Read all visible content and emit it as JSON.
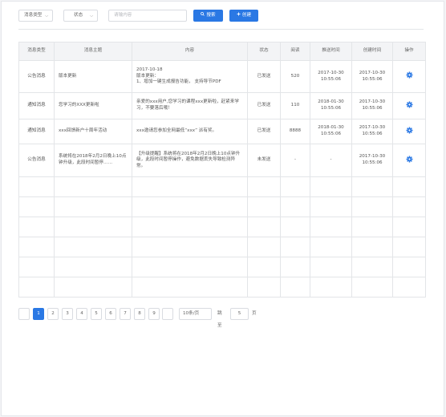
{
  "toolbar": {
    "type_select": "消息类型",
    "status_select": "状态",
    "search_placeholder": "请输内容",
    "search_button": "搜索",
    "create_button": "创建"
  },
  "table": {
    "columns": [
      "消息类型",
      "消息主题",
      "内容",
      "状态",
      "阅读",
      "推送时间",
      "创建时间",
      "操作"
    ],
    "rows": [
      {
        "type": "公告消息",
        "subject": "版本更新",
        "content": "2017-10-18\n版本更新：\n1、增加一键生成报告功能， 支持导节PDF",
        "status": "已发送",
        "reads": "520",
        "push_time": "2017-10-30\n10:55:06",
        "create_time": "2017-10-30\n10:55:06"
      },
      {
        "type": "通知消息",
        "subject": "您学习的XXX更新啦",
        "content": "亲爱的xxx用户,您学习的课程xxx更新啦，赶紧来学习，不要落后哦！",
        "status": "已发送",
        "reads": "110",
        "push_time": "2018-01-30\n10:55:06",
        "create_time": "2017-10-30\n10:55:06"
      },
      {
        "type": "通知消息",
        "subject": "xxx回馈新户十周年活动",
        "content": "xxx邀请您参加全网最低“xxx” 派有奖。",
        "status": "已发送",
        "reads": "8888",
        "push_time": "2018-01-30\n10:55:06",
        "create_time": "2017-10-30\n10:55:06"
      },
      {
        "type": "公告消息",
        "subject": "系统将在2018年2月2日晚上10点钟升级，此段时间暂停……",
        "content": "【升级提醒】系统将在2018年2月2日晚上10点钟升级，此段时间暂停操作，避免数据丢失导致检测异常。",
        "status": "未发送",
        "reads": "-",
        "push_time": "-",
        "create_time": "2017-10-30\n10:55:06"
      }
    ],
    "action_icon": "gear-icon"
  },
  "pagination": {
    "prev": "",
    "pages": [
      "1",
      "2",
      "3",
      "4",
      "5",
      "6",
      "7",
      "8",
      "9"
    ],
    "current": "1",
    "next": "",
    "page_size": "10条/页",
    "goto_label": "跳至",
    "goto_value": "5",
    "goto_unit": "页"
  },
  "colors": {
    "primary": "#2a78e4",
    "header_bg": "#f3f4f6",
    "border": "#e3e5e8"
  }
}
